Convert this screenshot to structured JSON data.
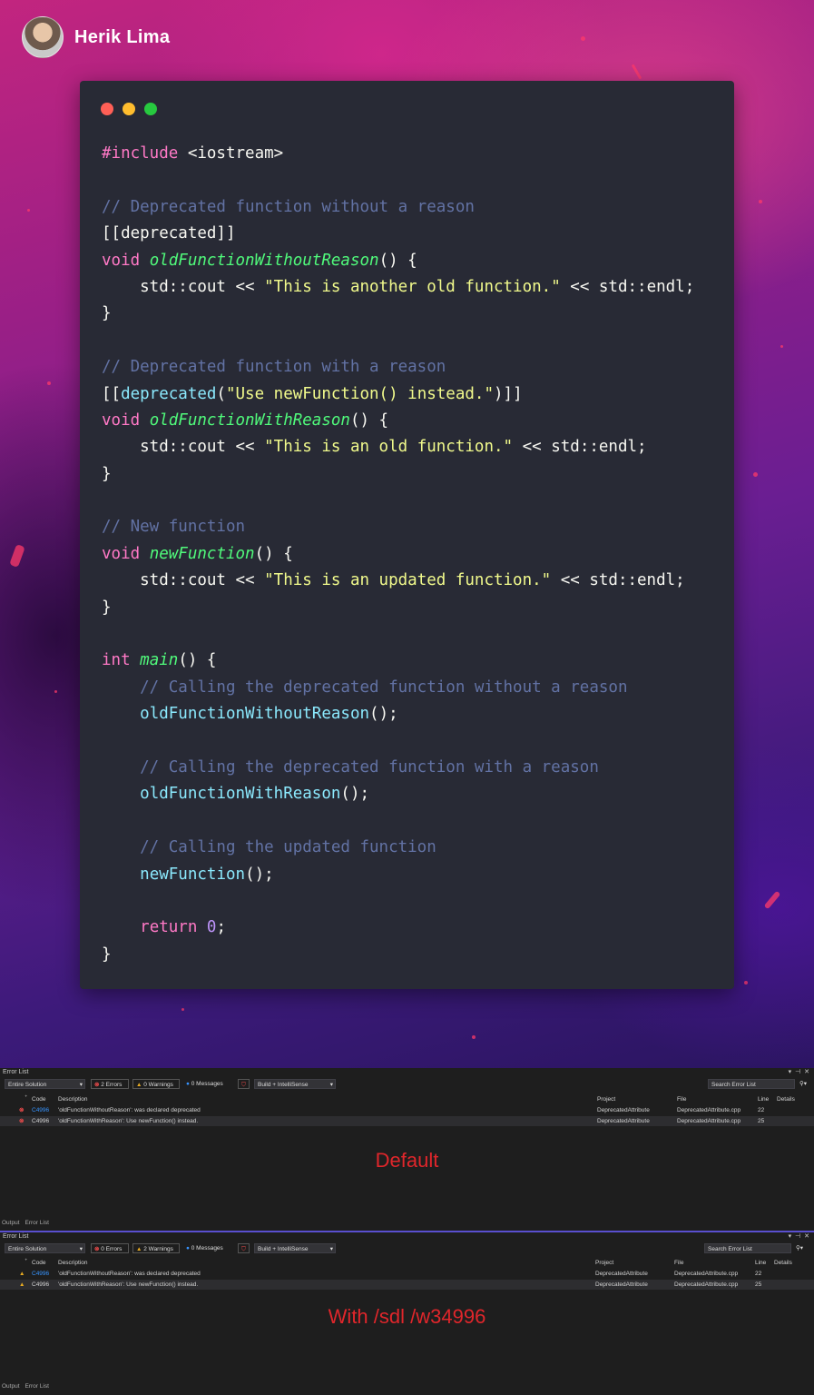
{
  "author": {
    "name": "Herik Lima"
  },
  "window_controls": {
    "close_color": "#ff5f56",
    "minimize_color": "#ffbd2e",
    "maximize_color": "#27c93f"
  },
  "code_lines": [
    [
      {
        "t": "#include ",
        "k": "k"
      },
      {
        "t": "<iostream>",
        "k": "p"
      }
    ],
    [],
    [
      {
        "t": "// Deprecated function without a reason",
        "k": "c"
      }
    ],
    [
      {
        "t": "[[deprecated]]",
        "k": "p"
      }
    ],
    [
      {
        "t": "void ",
        "k": "k"
      },
      {
        "t": "oldFunctionWithoutReason",
        "k": "f"
      },
      {
        "t": "() {",
        "k": "p"
      }
    ],
    [
      {
        "t": "    std::cout << ",
        "k": "p"
      },
      {
        "t": "\"This is another old function.\"",
        "k": "s"
      },
      {
        "t": " << std::endl;",
        "k": "p"
      }
    ],
    [
      {
        "t": "}",
        "k": "p"
      }
    ],
    [],
    [
      {
        "t": "// Deprecated function with a reason",
        "k": "c"
      }
    ],
    [
      {
        "t": "[[",
        "k": "p"
      },
      {
        "t": "deprecated",
        "k": "cl"
      },
      {
        "t": "(",
        "k": "p"
      },
      {
        "t": "\"Use newFunction() instead.\"",
        "k": "s"
      },
      {
        "t": ")]]",
        "k": "p"
      }
    ],
    [
      {
        "t": "void ",
        "k": "k"
      },
      {
        "t": "oldFunctionWithReason",
        "k": "f"
      },
      {
        "t": "() {",
        "k": "p"
      }
    ],
    [
      {
        "t": "    std::cout << ",
        "k": "p"
      },
      {
        "t": "\"This is an old function.\"",
        "k": "s"
      },
      {
        "t": " << std::endl;",
        "k": "p"
      }
    ],
    [
      {
        "t": "}",
        "k": "p"
      }
    ],
    [],
    [
      {
        "t": "// New function",
        "k": "c"
      }
    ],
    [
      {
        "t": "void ",
        "k": "k"
      },
      {
        "t": "newFunction",
        "k": "f"
      },
      {
        "t": "() {",
        "k": "p"
      }
    ],
    [
      {
        "t": "    std::cout << ",
        "k": "p"
      },
      {
        "t": "\"This is an updated function.\"",
        "k": "s"
      },
      {
        "t": " << std::endl;",
        "k": "p"
      }
    ],
    [
      {
        "t": "}",
        "k": "p"
      }
    ],
    [],
    [
      {
        "t": "int ",
        "k": "k"
      },
      {
        "t": "main",
        "k": "f"
      },
      {
        "t": "() {",
        "k": "p"
      }
    ],
    [
      {
        "t": "    // Calling the deprecated function without a reason",
        "k": "c"
      }
    ],
    [
      {
        "t": "    ",
        "k": "p"
      },
      {
        "t": "oldFunctionWithoutReason",
        "k": "cl"
      },
      {
        "t": "();",
        "k": "p"
      }
    ],
    [],
    [
      {
        "t": "    // Calling the deprecated function with a reason",
        "k": "c"
      }
    ],
    [
      {
        "t": "    ",
        "k": "p"
      },
      {
        "t": "oldFunctionWithReason",
        "k": "cl"
      },
      {
        "t": "();",
        "k": "p"
      }
    ],
    [],
    [
      {
        "t": "    // Calling the updated function",
        "k": "c"
      }
    ],
    [
      {
        "t": "    ",
        "k": "p"
      },
      {
        "t": "newFunction",
        "k": "cl"
      },
      {
        "t": "();",
        "k": "p"
      }
    ],
    [],
    [
      {
        "t": "    ",
        "k": "p"
      },
      {
        "t": "return ",
        "k": "k"
      },
      {
        "t": "0",
        "k": "n"
      },
      {
        "t": ";",
        "k": "p"
      }
    ],
    [
      {
        "t": "}",
        "k": "p"
      }
    ]
  ],
  "panel_default": {
    "title": "Error List",
    "window_buttons": "▾ ⊣ ✕",
    "scope": "Entire Solution",
    "errors": "2 Errors",
    "warnings": "0 Warnings",
    "messages": "0 Messages",
    "build_filter": "Build + IntelliSense",
    "search_placeholder": "Search Error List",
    "columns": {
      "code": "Code",
      "description": "Description",
      "project": "Project",
      "file": "File",
      "line": "Line",
      "details": "Details"
    },
    "rows": [
      {
        "severity": "error",
        "code": "C4996",
        "description": "'oldFunctionWithoutReason': was declared deprecated",
        "project": "DeprecatedAttribute",
        "file": "DeprecatedAttribute.cpp",
        "line": "22"
      },
      {
        "severity": "error",
        "code": "C4996",
        "description": "'oldFunctionWithReason': Use newFunction() instead.",
        "project": "DeprecatedAttribute",
        "file": "DeprecatedAttribute.cpp",
        "line": "25"
      }
    ],
    "tabs": [
      "Output",
      "Error List"
    ],
    "caption": "Default"
  },
  "panel_sdl": {
    "title": "Error List",
    "window_buttons": "▾ ⊣ ✕",
    "scope": "Entire Solution",
    "errors": "0 Errors",
    "warnings": "2 Warnings",
    "messages": "0 Messages",
    "build_filter": "Build + IntelliSense",
    "search_placeholder": "Search Error List",
    "columns": {
      "code": "Code",
      "description": "Description",
      "project": "Project",
      "file": "File",
      "line": "Line",
      "details": "Details"
    },
    "rows": [
      {
        "severity": "warning",
        "code": "C4996",
        "description": "'oldFunctionWithoutReason': was declared deprecated",
        "project": "DeprecatedAttribute",
        "file": "DeprecatedAttribute.cpp",
        "line": "22"
      },
      {
        "severity": "warning",
        "code": "C4996",
        "description": "'oldFunctionWithReason': Use newFunction() instead.",
        "project": "DeprecatedAttribute",
        "file": "DeprecatedAttribute.cpp",
        "line": "25"
      }
    ],
    "tabs": [
      "Output",
      "Error List"
    ],
    "caption": "With /sdl /w34996"
  }
}
